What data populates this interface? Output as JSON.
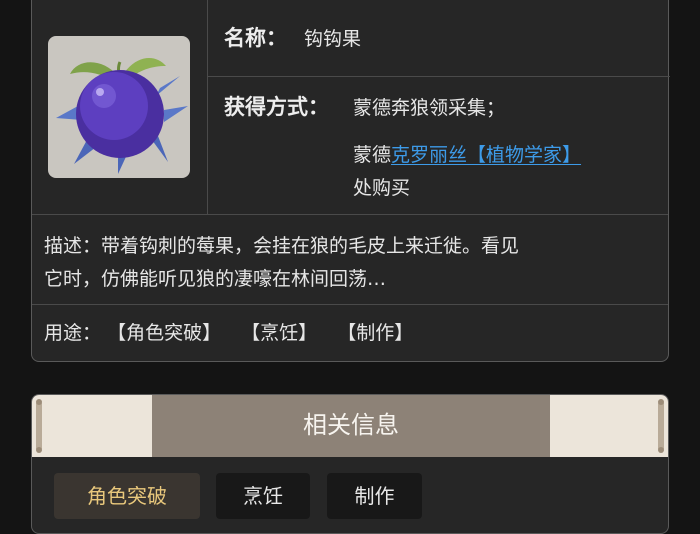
{
  "item": {
    "name_label": "名称：",
    "name": "钩钩果",
    "obtain_label": "获得方式：",
    "obtain_line1": "蒙德奔狼领采集；",
    "obtain_line2_prefix": "蒙德",
    "obtain_npc_link": "克罗丽丝【植物学家】",
    "obtain_line3": "处购买",
    "desc_line1": "描述：带着钩刺的莓果，会挂在狼的毛皮上来迁徙。看见",
    "desc_line2": "它时，仿佛能听见狼的凄嚎在林间回荡…",
    "uses_label": "用途：",
    "uses": [
      "【角色突破】",
      "【烹饪】",
      "【制作】"
    ],
    "image_icon": "valberry-icon"
  },
  "related": {
    "title": "相关信息",
    "tabs": [
      "角色突破",
      "烹饪",
      "制作"
    ],
    "active_tab": 0
  },
  "colors": {
    "background": "#141414",
    "card": "#262626",
    "link": "#3d9be9",
    "active_tab_text": "#e9c87c",
    "header_band": "#8d8277"
  }
}
